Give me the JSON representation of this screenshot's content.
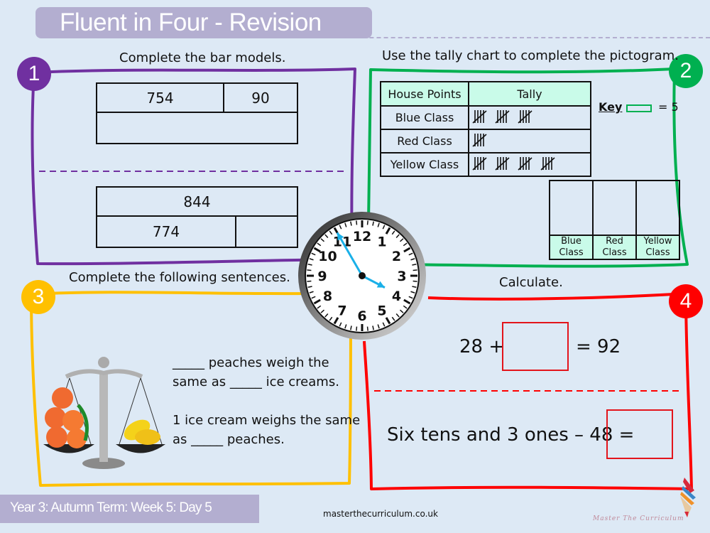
{
  "header": {
    "title": "Fluent in Four - Revision"
  },
  "footer": {
    "term_label": "Year 3: Autumn Term: Week 5: Day 5",
    "website": "masterthecurriculum.co.uk",
    "brand": "Master The Curriculum"
  },
  "colors": {
    "q1": "#7030a0",
    "q2": "#00b050",
    "q3": "#ffc000",
    "q4": "#ff0000",
    "banner": "#b3aed0",
    "table_header": "#c9fbe9",
    "clock_hands": "#1ab0e8"
  },
  "q1": {
    "number": "1",
    "instruction": "Complete the bar models.",
    "bar1": {
      "top_parts": [
        "754",
        "90"
      ],
      "whole": ""
    },
    "bar2": {
      "whole": "844",
      "bottom_parts": [
        "774",
        ""
      ]
    }
  },
  "q2": {
    "number": "2",
    "instruction": "Use the tally chart to complete the pictogram.",
    "table": {
      "headers": [
        "House Points",
        "Tally"
      ],
      "rows": [
        {
          "label": "Blue Class",
          "tally_groups": 3
        },
        {
          "label": "Red Class",
          "tally_groups": 1
        },
        {
          "label": "Yellow Class",
          "tally_groups": 4
        }
      ]
    },
    "key": {
      "label": "Key",
      "value": "= 5"
    },
    "pictogram": {
      "columns": [
        [
          "Blue",
          "Class"
        ],
        [
          "Red",
          "Class"
        ],
        [
          "Yellow",
          "Class"
        ]
      ]
    }
  },
  "clock": {
    "numbers": [
      "12",
      "1",
      "2",
      "3",
      "4",
      "5",
      "6",
      "7",
      "8",
      "9",
      "10",
      "11"
    ],
    "time_hours": 3,
    "time_minutes": 55
  },
  "q3": {
    "number": "3",
    "instruction": "Complete the following sentences.",
    "sentences": [
      [
        "_____ peaches weigh the",
        "same as _____ ice creams."
      ],
      [
        "1 ice cream weighs the same",
        "as _____ peaches."
      ]
    ],
    "image": "balance-scale-peaches-ice-creams"
  },
  "q4": {
    "number": "4",
    "instruction": "Calculate.",
    "calc1": {
      "left": "28 +",
      "right": "= 92"
    },
    "calc2": {
      "left": "Six tens and 3 ones – 48 ="
    }
  }
}
